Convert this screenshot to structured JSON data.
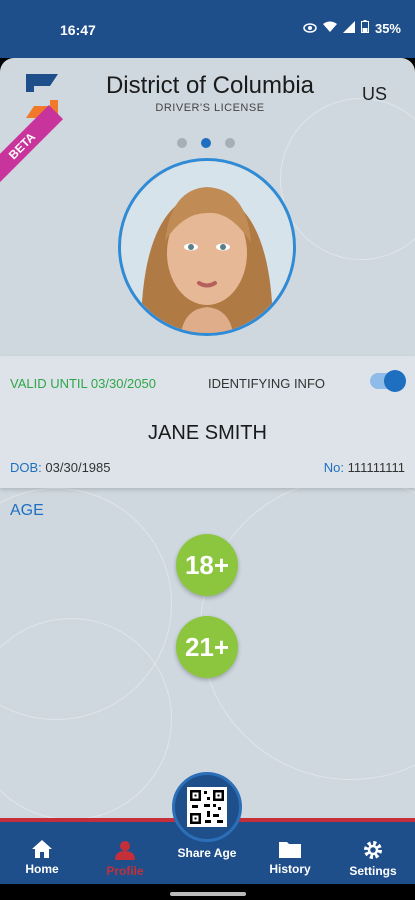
{
  "status": {
    "time": "16:47",
    "battery": "35%"
  },
  "header": {
    "state": "District of Columbia",
    "doc_type": "DRIVER'S LICENSE",
    "country": "US",
    "beta": "BETA"
  },
  "carousel": {
    "pages": 3,
    "active": 2
  },
  "license": {
    "valid_until": "VALID UNTIL 03/30/2050",
    "identifying_label": "IDENTIFYING INFO",
    "identifying_on": true,
    "name": "JANE SMITH",
    "dob_label": "DOB:",
    "dob": "03/30/1985",
    "no_label": "No:",
    "number": "111111111"
  },
  "age": {
    "label": "AGE",
    "badges": [
      "18+",
      "21+"
    ]
  },
  "nav": {
    "home": "Home",
    "profile": "Profile",
    "share": "Share Age",
    "history": "History",
    "settings": "Settings"
  },
  "colors": {
    "brand_blue": "#1e4f8a",
    "accent_blue": "#1f6fc0",
    "green": "#8cc63f",
    "red": "#c42f3a",
    "beta_pink": "#c8349b"
  }
}
